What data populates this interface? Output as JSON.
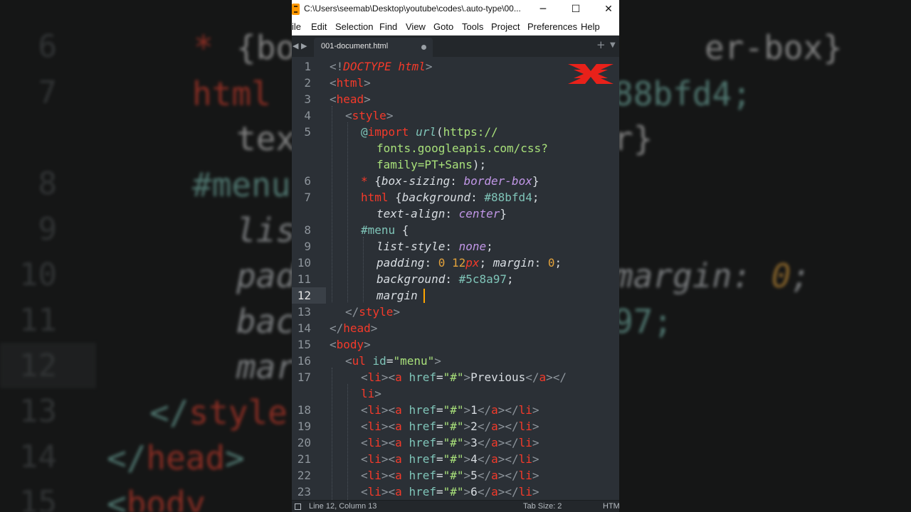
{
  "window": {
    "title": "C:\\Users\\seemab\\Desktop\\youtube\\codes\\.auto-type\\00...",
    "minimize": "─",
    "maximize": "☐",
    "close": "✕"
  },
  "menu": [
    "ile",
    "Edit",
    "Selection",
    "Find",
    "View",
    "Goto",
    "Tools",
    "Project",
    "Preferences",
    "Help"
  ],
  "tab": {
    "name": "001-document.html"
  },
  "status": {
    "position": "Line 12, Column 13",
    "tab_size": "Tab Size: 2",
    "syntax": "HTM"
  },
  "editor": {
    "current_line": 12,
    "lines": [
      {
        "num": "1",
        "text": "<!DOCTYPE html>"
      },
      {
        "num": "2",
        "text": "<html>"
      },
      {
        "num": "3",
        "text": "<head>"
      },
      {
        "num": "4",
        "text": "  <style>"
      },
      {
        "num": "5",
        "text": "    @import url(https://"
      },
      {
        "num": "",
        "text": "      fonts.googleapis.com/css?"
      },
      {
        "num": "",
        "text": "      family=PT+Sans);"
      },
      {
        "num": "6",
        "text": "    * {box-sizing: border-box}"
      },
      {
        "num": "7",
        "text": "    html {background: #88bfd4;"
      },
      {
        "num": "",
        "text": "      text-align: center}"
      },
      {
        "num": "8",
        "text": "    #menu {"
      },
      {
        "num": "9",
        "text": "      list-style: none;"
      },
      {
        "num": "10",
        "text": "      padding: 0 12px; margin: 0;"
      },
      {
        "num": "11",
        "text": "      background: #5c8a97;"
      },
      {
        "num": "12",
        "text": "      margin"
      },
      {
        "num": "13",
        "text": "  </style>"
      },
      {
        "num": "14",
        "text": "</head>"
      },
      {
        "num": "15",
        "text": "<body>"
      },
      {
        "num": "16",
        "text": "  <ul id=\"menu\">"
      },
      {
        "num": "17",
        "text": "    <li><a href=\"#\">Previous</a></"
      },
      {
        "num": "",
        "text": "    li>"
      },
      {
        "num": "18",
        "text": "    <li><a href=\"#\">1</a></li>"
      },
      {
        "num": "19",
        "text": "    <li><a href=\"#\">2</a></li>"
      },
      {
        "num": "20",
        "text": "    <li><a href=\"#\">3</a></li>"
      },
      {
        "num": "21",
        "text": "    <li><a href=\"#\">4</a></li>"
      },
      {
        "num": "22",
        "text": "    <li><a href=\"#\">5</a></li>"
      },
      {
        "num": "23",
        "text": "    <li><a href=\"#\">6</a></li>"
      }
    ]
  },
  "colors": {
    "editor_bg": "#2b3036",
    "tag": "#f53a2a",
    "attribute_cyan": "#7fc4b8",
    "value_purple": "#c297e8",
    "number_orange": "#e3a23b",
    "string_green": "#a8e07a",
    "caret": "#ffa500"
  },
  "icons": [
    "sublime-text-icon",
    "minimize-icon",
    "maximize-icon",
    "close-icon",
    "tab-scroll-left-icon",
    "tab-scroll-right-icon",
    "new-tab-plus-icon",
    "tab-list-dropdown-icon",
    "modified-dot-icon",
    "channel-logo-icon",
    "panel-toggle-icon"
  ]
}
